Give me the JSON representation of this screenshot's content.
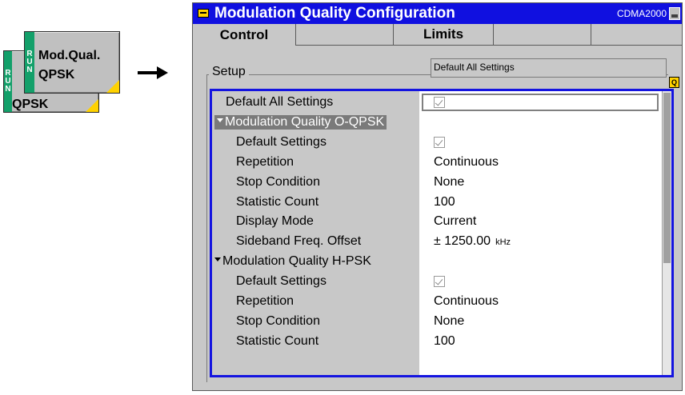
{
  "softkeys": {
    "back": {
      "run": [
        "R",
        "U",
        "N"
      ],
      "line1": "",
      "line2": "QPSK"
    },
    "front": {
      "run": [
        "R",
        "U",
        "N"
      ],
      "line1": "Mod.Qual.",
      "line2": "QPSK"
    }
  },
  "window": {
    "title": "Modulation Quality Configuration",
    "mode": "CDMA2000",
    "tabs": [
      "Control",
      "",
      "Limits",
      "",
      ""
    ]
  },
  "setup": {
    "group_label": "Setup",
    "default_button": "Default All Settings",
    "q_icon": "Q"
  },
  "tree": [
    {
      "label": "Default All Settings",
      "indent": 0,
      "type": "check"
    },
    {
      "label": "Modulation Quality O-QPSK",
      "indent": 0,
      "type": "header",
      "highlight": true
    },
    {
      "label": "Default Settings",
      "indent": 1,
      "type": "check"
    },
    {
      "label": "Repetition",
      "indent": 1,
      "value": "Continuous"
    },
    {
      "label": "Stop Condition",
      "indent": 1,
      "value": "None"
    },
    {
      "label": "Statistic Count",
      "indent": 1,
      "value": "100"
    },
    {
      "label": "Display Mode",
      "indent": 1,
      "value": "Current"
    },
    {
      "label": "Sideband Freq. Offset",
      "indent": 1,
      "value": "± 1250.00",
      "unit": "kHz"
    },
    {
      "label": "Modulation Quality H-PSK",
      "indent": 0,
      "type": "header"
    },
    {
      "label": "Default Settings",
      "indent": 1,
      "type": "check"
    },
    {
      "label": "Repetition",
      "indent": 1,
      "value": "Continuous"
    },
    {
      "label": "Stop Condition",
      "indent": 1,
      "value": "None"
    },
    {
      "label": "Statistic Count",
      "indent": 1,
      "value": "100"
    }
  ],
  "colors": {
    "title_bar": "#1010e0",
    "run_green": "#13a06a",
    "corner_yellow": "#ffd200",
    "tree_border": "#1414e0"
  }
}
